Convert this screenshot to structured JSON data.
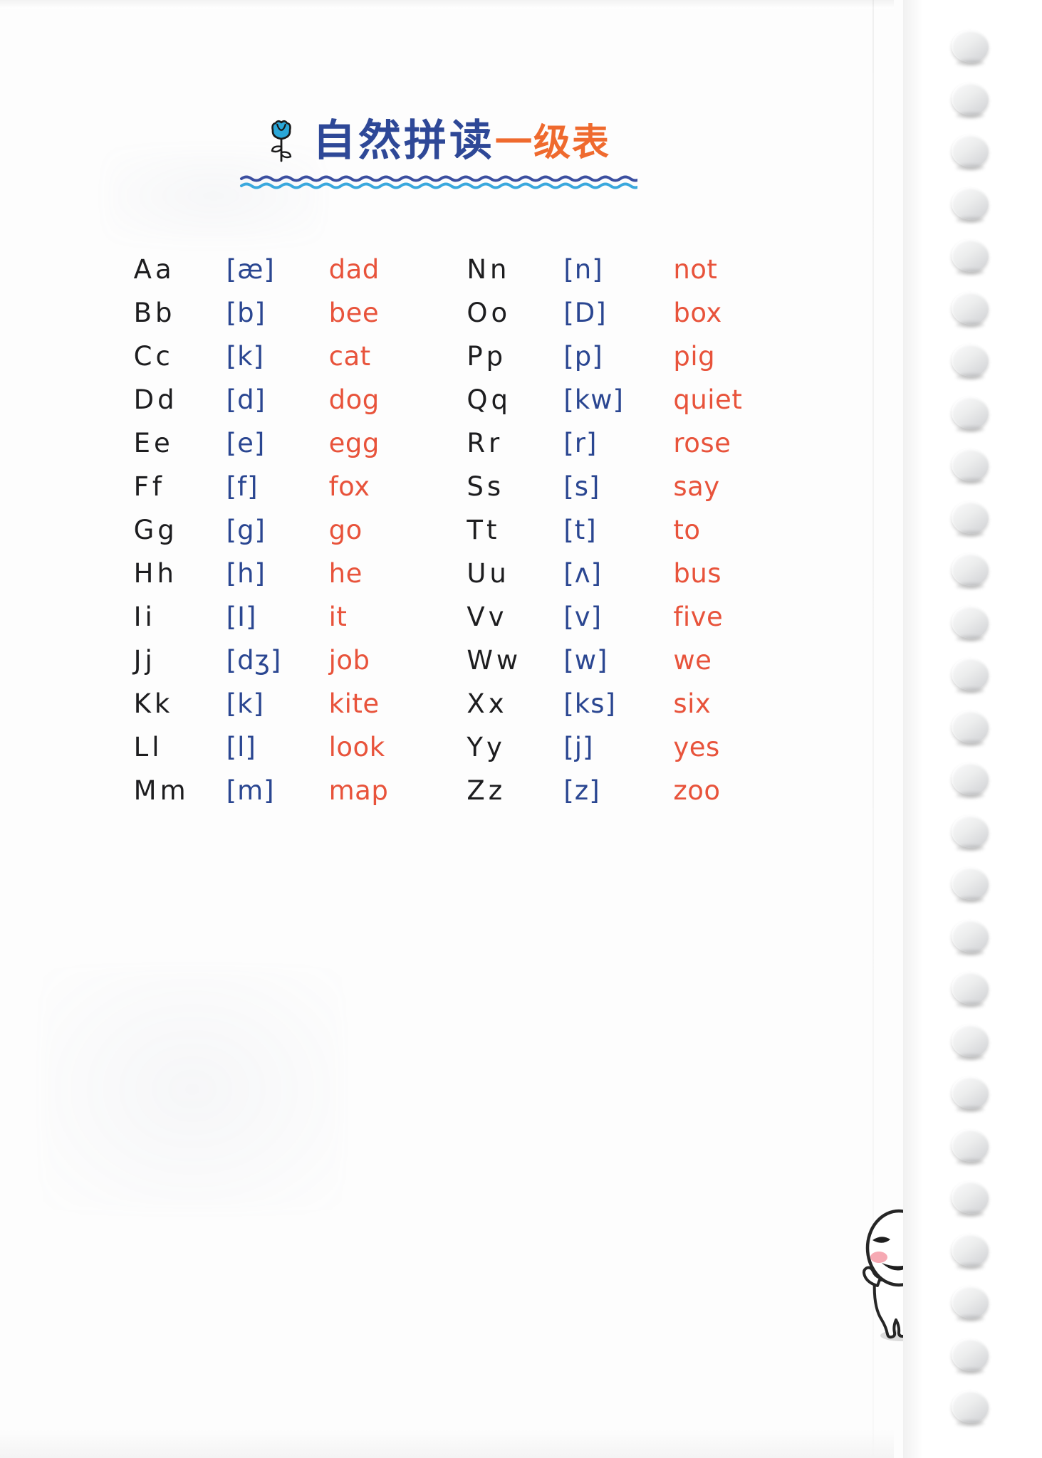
{
  "page": {
    "background_color": "#fdfdfd",
    "binding_ring_count": 27
  },
  "header": {
    "icon": "tulip-flower-icon",
    "title_main": "自然拼读",
    "title_accent": "一级表",
    "title_full": "自然拼读一级表",
    "underline_style": "double-wavy",
    "colors": {
      "title_blue": "#2e4897",
      "title_orange": "#ef6a2e",
      "wave_dark": "#3b4fa0",
      "wave_light": "#3aa8dd"
    }
  },
  "colors": {
    "letter": "#1d1d1f",
    "ipa": "#2a4691",
    "word": "#e8533b"
  },
  "table": {
    "columns": [
      "letter",
      "ipa",
      "word"
    ],
    "left": [
      {
        "letter": "Aa",
        "ipa": "[æ]",
        "word": "dad"
      },
      {
        "letter": "Bb",
        "ipa": "[b]",
        "word": "bee"
      },
      {
        "letter": "Cc",
        "ipa": "[k]",
        "word": "cat"
      },
      {
        "letter": "Dd",
        "ipa": "[d]",
        "word": "dog"
      },
      {
        "letter": "Ee",
        "ipa": "[e]",
        "word": "egg"
      },
      {
        "letter": "Ff",
        "ipa": "[f]",
        "word": "fox"
      },
      {
        "letter": "Gg",
        "ipa": "[g]",
        "word": "go"
      },
      {
        "letter": "Hh",
        "ipa": "[h]",
        "word": "he"
      },
      {
        "letter": "Ii",
        "ipa": "[I]",
        "word": "it"
      },
      {
        "letter": "Jj",
        "ipa": "[dʒ]",
        "word": "job"
      },
      {
        "letter": "Kk",
        "ipa": "[k]",
        "word": "kite"
      },
      {
        "letter": "Ll",
        "ipa": "[l]",
        "word": "look"
      },
      {
        "letter": "Mm",
        "ipa": "[m]",
        "word": "map"
      }
    ],
    "right": [
      {
        "letter": "Nn",
        "ipa": "[n]",
        "word": "not"
      },
      {
        "letter": "Oo",
        "ipa": "[D]",
        "word": "box"
      },
      {
        "letter": "Pp",
        "ipa": "[p]",
        "word": "pig"
      },
      {
        "letter": "Qq",
        "ipa": "[kw]",
        "word": "quiet"
      },
      {
        "letter": "Rr",
        "ipa": "[r]",
        "word": "rose"
      },
      {
        "letter": "Ss",
        "ipa": "[s]",
        "word": "say"
      },
      {
        "letter": "Tt",
        "ipa": "[t]",
        "word": "to"
      },
      {
        "letter": "Uu",
        "ipa": "[ʌ]",
        "word": "bus"
      },
      {
        "letter": "Vv",
        "ipa": "[v]",
        "word": "five"
      },
      {
        "letter": "Ww",
        "ipa": "[w]",
        "word": "we"
      },
      {
        "letter": "Xx",
        "ipa": "[ks]",
        "word": "six"
      },
      {
        "letter": "Yy",
        "ipa": "[j]",
        "word": "yes"
      },
      {
        "letter": "Zz",
        "ipa": "[z]",
        "word": "zoo"
      }
    ]
  },
  "decorations": {
    "mascot": "waving-cartoon-mascot-icon"
  }
}
